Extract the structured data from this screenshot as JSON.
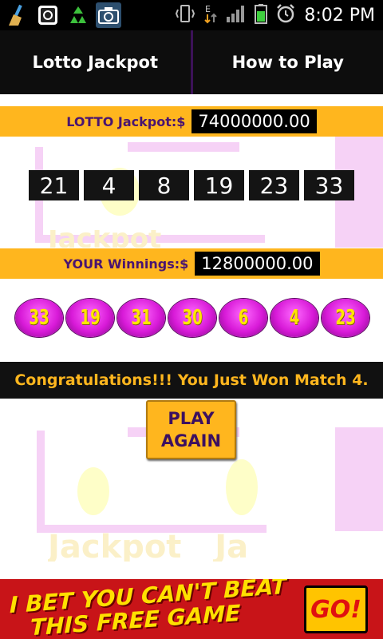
{
  "status_bar": {
    "time": "8:02 PM",
    "icons": [
      "broom-icon",
      "instagram-icon",
      "recycle-icon",
      "camera-icon",
      "vibrate-icon",
      "data-e-icon",
      "signal-icon",
      "battery-icon",
      "alarm-icon"
    ]
  },
  "tabs": [
    {
      "label": "Lotto Jackpot"
    },
    {
      "label": "How to Play"
    }
  ],
  "jackpot": {
    "label": "LOTTO Jackpot:$",
    "value": "74000000.00",
    "numbers": [
      "21",
      "4",
      "8",
      "19",
      "23",
      "33"
    ]
  },
  "winnings": {
    "label": "YOUR Winnings:$",
    "value": "12800000.00",
    "balls": [
      "33",
      "19",
      "31",
      "30",
      "6",
      "4",
      "23"
    ]
  },
  "message": "Congratulations!!! You Just Won Match 4.",
  "play_again": {
    "line1": "PLAY",
    "line2": "AGAIN"
  },
  "ad": {
    "line1": "I BET YOU CAN'T BEAT",
    "line2": "THIS FREE GAME",
    "go": "GO!"
  },
  "colors": {
    "accent_orange": "#ffb61e",
    "label_purple": "#4a1470",
    "ball_magenta": "#d81ad8",
    "ad_red": "#c81418"
  }
}
